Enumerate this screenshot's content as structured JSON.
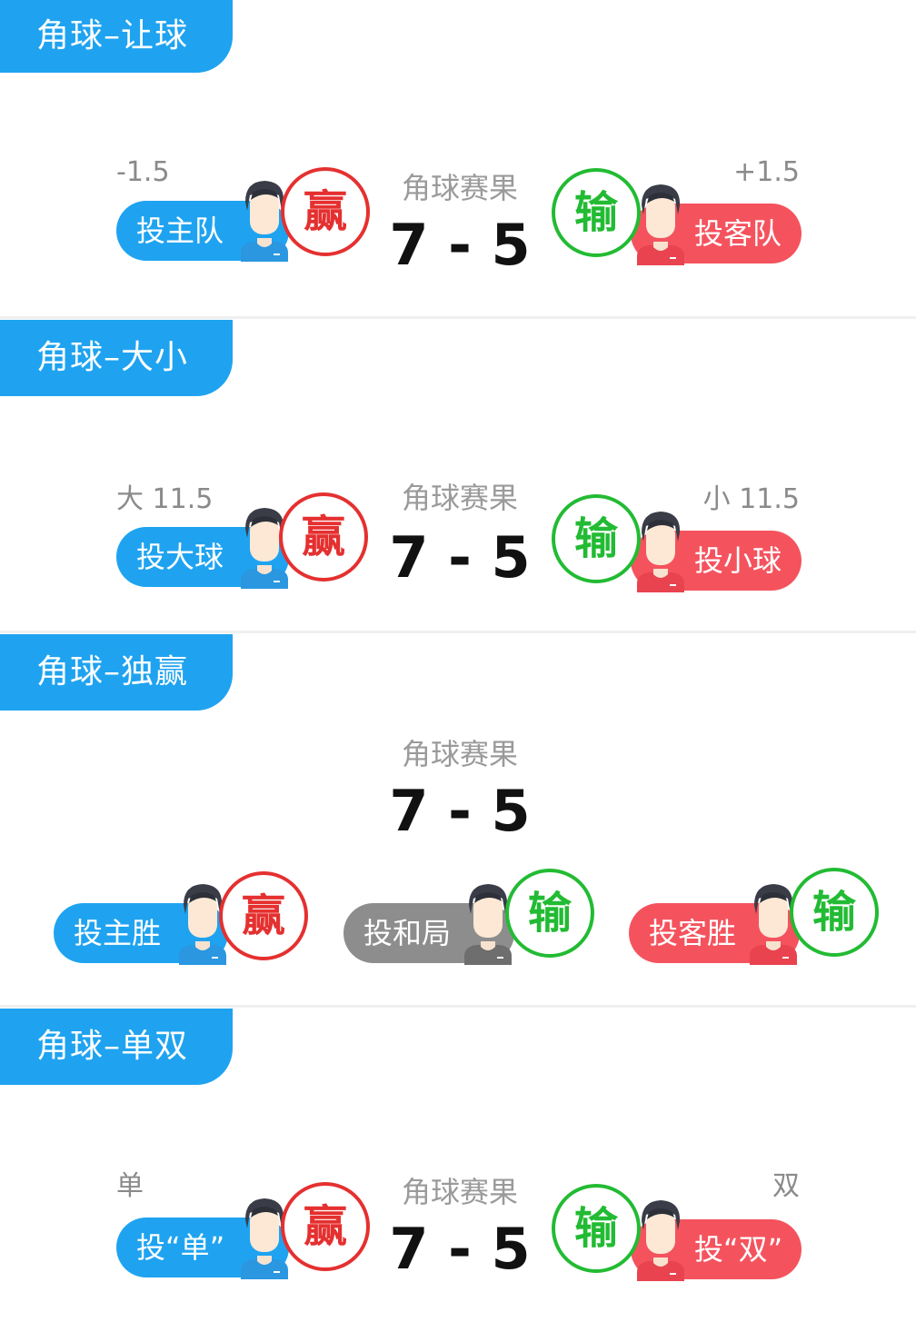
{
  "colors": {
    "accent_blue": "#1fa3f0",
    "away_red": "#f4535e",
    "draw_gray": "#8d8d8d",
    "win_red": "#e53030",
    "lose_green": "#22bb33"
  },
  "sections": [
    {
      "title": "角球–让球",
      "result_label": "角球赛果",
      "score": "7 - 5",
      "home": {
        "line": "-1.5",
        "bet_label": "投主队",
        "result": "赢"
      },
      "away": {
        "line": "+1.5",
        "bet_label": "投客队",
        "result": "输"
      }
    },
    {
      "title": "角球–大小",
      "result_label": "角球赛果",
      "score": "7 - 5",
      "home": {
        "line": "大 11.5",
        "bet_label": "投大球",
        "result": "赢"
      },
      "away": {
        "line": "小 11.5",
        "bet_label": "投小球",
        "result": "输"
      }
    },
    {
      "title": "角球–独赢",
      "result_label": "角球赛果",
      "score": "7 - 5",
      "options": [
        {
          "bet_label": "投主胜",
          "result": "赢"
        },
        {
          "bet_label": "投和局",
          "result": "输"
        },
        {
          "bet_label": "投客胜",
          "result": "输"
        }
      ]
    },
    {
      "title": "角球–单双",
      "result_label": "角球赛果",
      "score": "7 - 5",
      "home": {
        "line": "单",
        "bet_label": "投“单”",
        "result": "赢"
      },
      "away": {
        "line": "双",
        "bet_label": "投“双”",
        "result": "输"
      }
    }
  ]
}
